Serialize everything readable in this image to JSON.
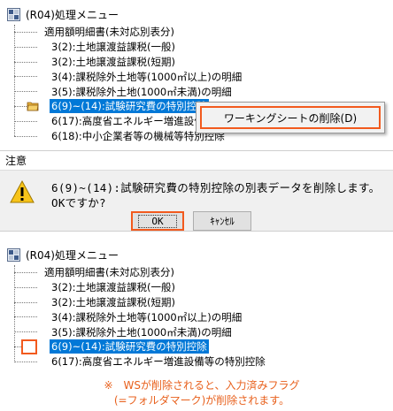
{
  "window_title": "(R04)処理メニュー",
  "tree_top": {
    "items": [
      "適用額明細書(未対応別表分)",
      "3(2):土地譲渡益課税(一般)",
      "3(2):土地譲渡益課税(短期)",
      "3(4):課税除外土地等(1000㎡以上)の明細",
      "3(5):課税除外土地(1000㎡未満)の明細",
      "6(9)~(14):試験研究費の特別控除",
      "6(17):高度省エネルギー増進設備等",
      "6(18):中小企業者等の機械等特別控除"
    ],
    "selected_index": 5
  },
  "context_menu": {
    "item_label": "ワーキングシートの削除(D)"
  },
  "dialog": {
    "title": "注意",
    "message_line1": "6(9)~(14):試験研究費の特別控除の別表データを削除します。",
    "message_line2": "OKですか?",
    "ok_label": "OK",
    "cancel_label": "ｷｬﾝｾﾙ"
  },
  "tree_bottom": {
    "items": [
      "適用額明細書(未対応別表分)",
      "3(2):土地譲渡益課税(一般)",
      "3(2):土地譲渡益課税(短期)",
      "3(4):課税除外土地等(1000㎡以上)の明細",
      "3(5):課税除外土地(1000㎡未満)の明細",
      "6(9)~(14):試験研究費の特別控除",
      "6(17):高度省エネルギー増進設備等の特別控除"
    ],
    "selected_index": 5
  },
  "note": {
    "line1": "※　WSが削除されると、入力済みフラグ",
    "line2": "(=フォルダマーク)が削除されます。"
  },
  "colors": {
    "highlight": "#f25a1e",
    "selection": "#0078d7",
    "note_text": "#e8601c"
  }
}
